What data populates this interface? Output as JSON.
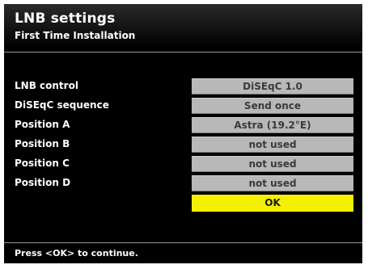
{
  "header": {
    "title": "LNB settings",
    "subtitle": "First Time Installation"
  },
  "settings": [
    {
      "label": "LNB control",
      "value": "DiSEqC 1.0"
    },
    {
      "label": "DiSEqC sequence",
      "value": "Send once"
    },
    {
      "label": "Position A",
      "value": "Astra (19.2°E)"
    },
    {
      "label": "Position B",
      "value": "not used"
    },
    {
      "label": "Position C",
      "value": "not used"
    },
    {
      "label": "Position D",
      "value": "not used"
    }
  ],
  "ok_button": {
    "label": "OK"
  },
  "footer": {
    "hint": "Press <OK> to continue."
  },
  "colors": {
    "background": "#000000",
    "value_field": "#b8b8b8",
    "highlight": "#f5f000",
    "text": "#ffffff"
  }
}
